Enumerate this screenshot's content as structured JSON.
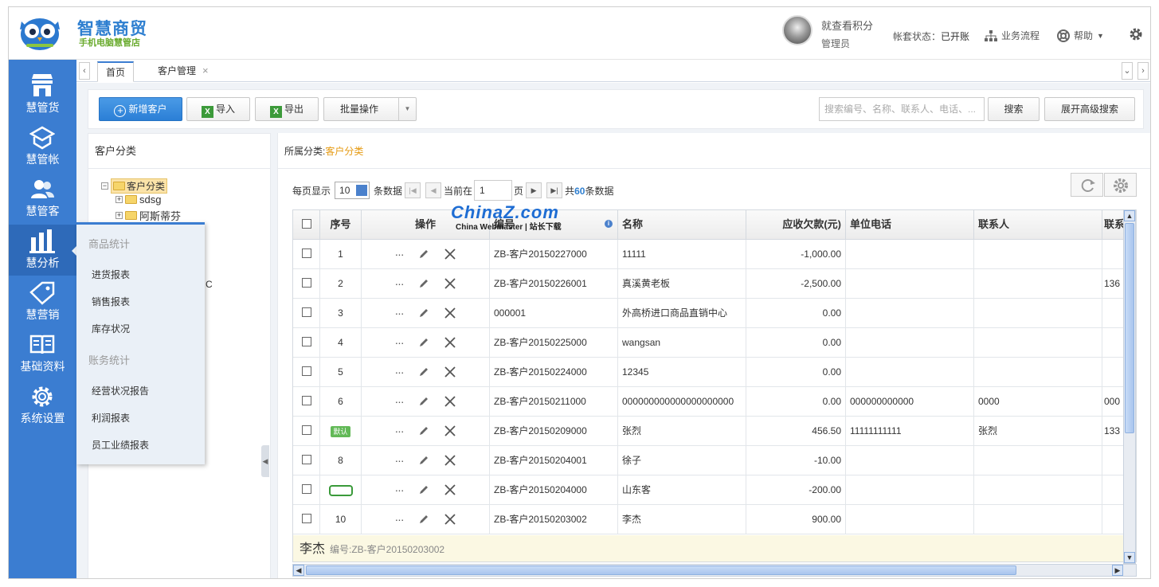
{
  "brand": {
    "name": "智慧商贸",
    "subtitle": "手机电脑慧管店"
  },
  "header": {
    "user_name": "就查看积分",
    "user_role": "管理员",
    "account_label": "帐套状态：",
    "account_value": "已开账",
    "workflow_label": "业务流程",
    "help_label": "帮助"
  },
  "sidebar": {
    "items": [
      {
        "label": "慧管货",
        "icon": "store-icon"
      },
      {
        "label": "慧管帐",
        "icon": "ledger-icon"
      },
      {
        "label": "慧管客",
        "icon": "users-icon"
      },
      {
        "label": "慧分析",
        "icon": "bar-chart-icon"
      },
      {
        "label": "慧营销",
        "icon": "tag-icon"
      },
      {
        "label": "基础资料",
        "icon": "book-icon"
      },
      {
        "label": "系统设置",
        "icon": "gear-icon"
      }
    ]
  },
  "popup": {
    "section1": "商品统计",
    "items1": [
      "进货报表",
      "销售报表",
      "库存状况"
    ],
    "section2": "账务统计",
    "items2": [
      "经营状况报告",
      "利润报表",
      "员工业绩报表"
    ]
  },
  "tabs": {
    "home": "首页",
    "customer": "客户管理",
    "close": "×"
  },
  "toolbar": {
    "new_customer": "新增客户",
    "import": "导入",
    "export": "导出",
    "batch": "批量操作",
    "search_placeholder": "搜索编号、名称、联系人、电话、...",
    "search": "搜索",
    "advanced": "展开高级搜索"
  },
  "left_panel": {
    "title": "客户分类",
    "tree": [
      {
        "label": "客户分类",
        "level": 0,
        "toggle": "⊟"
      },
      {
        "label": "sdsg",
        "level": 1,
        "toggle": "⊞"
      },
      {
        "label": "阿斯蒂芬",
        "level": 1,
        "toggle": "⊞"
      }
    ],
    "stray": "C"
  },
  "breadcrumb": {
    "prefix": "所属分类:",
    "current": "客户分类"
  },
  "pager": {
    "per_page_label": "每页显示",
    "per_page": "10",
    "per_page_suffix": "条数据",
    "current_label": "当前在",
    "current": "1",
    "page_suffix": "页",
    "total_prefix": "共",
    "total": "60",
    "total_suffix": "条数据"
  },
  "columns": [
    "序号",
    "操作",
    "编号",
    "名称",
    "应收欠款(元)",
    "单位电话",
    "联系人",
    "联系电话"
  ],
  "rows": [
    {
      "seq": "1",
      "code": "ZB-客户20150227000",
      "name": "11111",
      "debt": "-1,000.00",
      "phone": "",
      "contact": "",
      "mobile": ""
    },
    {
      "seq": "2",
      "code": "ZB-客户20150226001",
      "name": "真溪黄老板",
      "debt": "-2,500.00",
      "phone": "",
      "contact": "",
      "mobile": "136"
    },
    {
      "seq": "3",
      "code": "000001",
      "name": "外高桥进口商品直销中心",
      "debt": "0.00",
      "phone": "",
      "contact": "",
      "mobile": ""
    },
    {
      "seq": "4",
      "code": "ZB-客户20150225000",
      "name": "wangsan",
      "debt": "0.00",
      "phone": "",
      "contact": "",
      "mobile": ""
    },
    {
      "seq": "5",
      "code": "ZB-客户20150224000",
      "name": "12345",
      "debt": "0.00",
      "phone": "",
      "contact": "",
      "mobile": ""
    },
    {
      "seq": "6",
      "code": "ZB-客户20150211000",
      "name": "000000000000000000000",
      "debt": "0.00",
      "phone": "000000000000",
      "contact": "0000",
      "mobile": "000"
    },
    {
      "seq": "默认",
      "code": "ZB-客户20150209000",
      "name": "张烈",
      "debt": "456.50",
      "phone": "11111111111",
      "contact": "张烈",
      "mobile": "133"
    },
    {
      "seq": "8",
      "code": "ZB-客户20150204001",
      "name": "徐子",
      "debt": "-10.00",
      "phone": "",
      "contact": "",
      "mobile": ""
    },
    {
      "seq": "",
      "code": "ZB-客户20150204000",
      "name": "山东客",
      "debt": "-200.00",
      "phone": "",
      "contact": "",
      "mobile": ""
    },
    {
      "seq": "10",
      "code": "ZB-客户20150203002",
      "name": "李杰",
      "debt": "900.00",
      "phone": "",
      "contact": "",
      "mobile": ""
    }
  ],
  "detail": {
    "name": "李杰",
    "code": "编号:ZB-客户20150203002"
  },
  "watermark": {
    "line1": "ChinaZ.com",
    "line2": "China Webmaster | 站长下载"
  },
  "colors": {
    "primary": "#3b7dd1",
    "brand": "#2e7fd0",
    "accent_orange": "#e69a12",
    "tag_green": "#62b957"
  }
}
